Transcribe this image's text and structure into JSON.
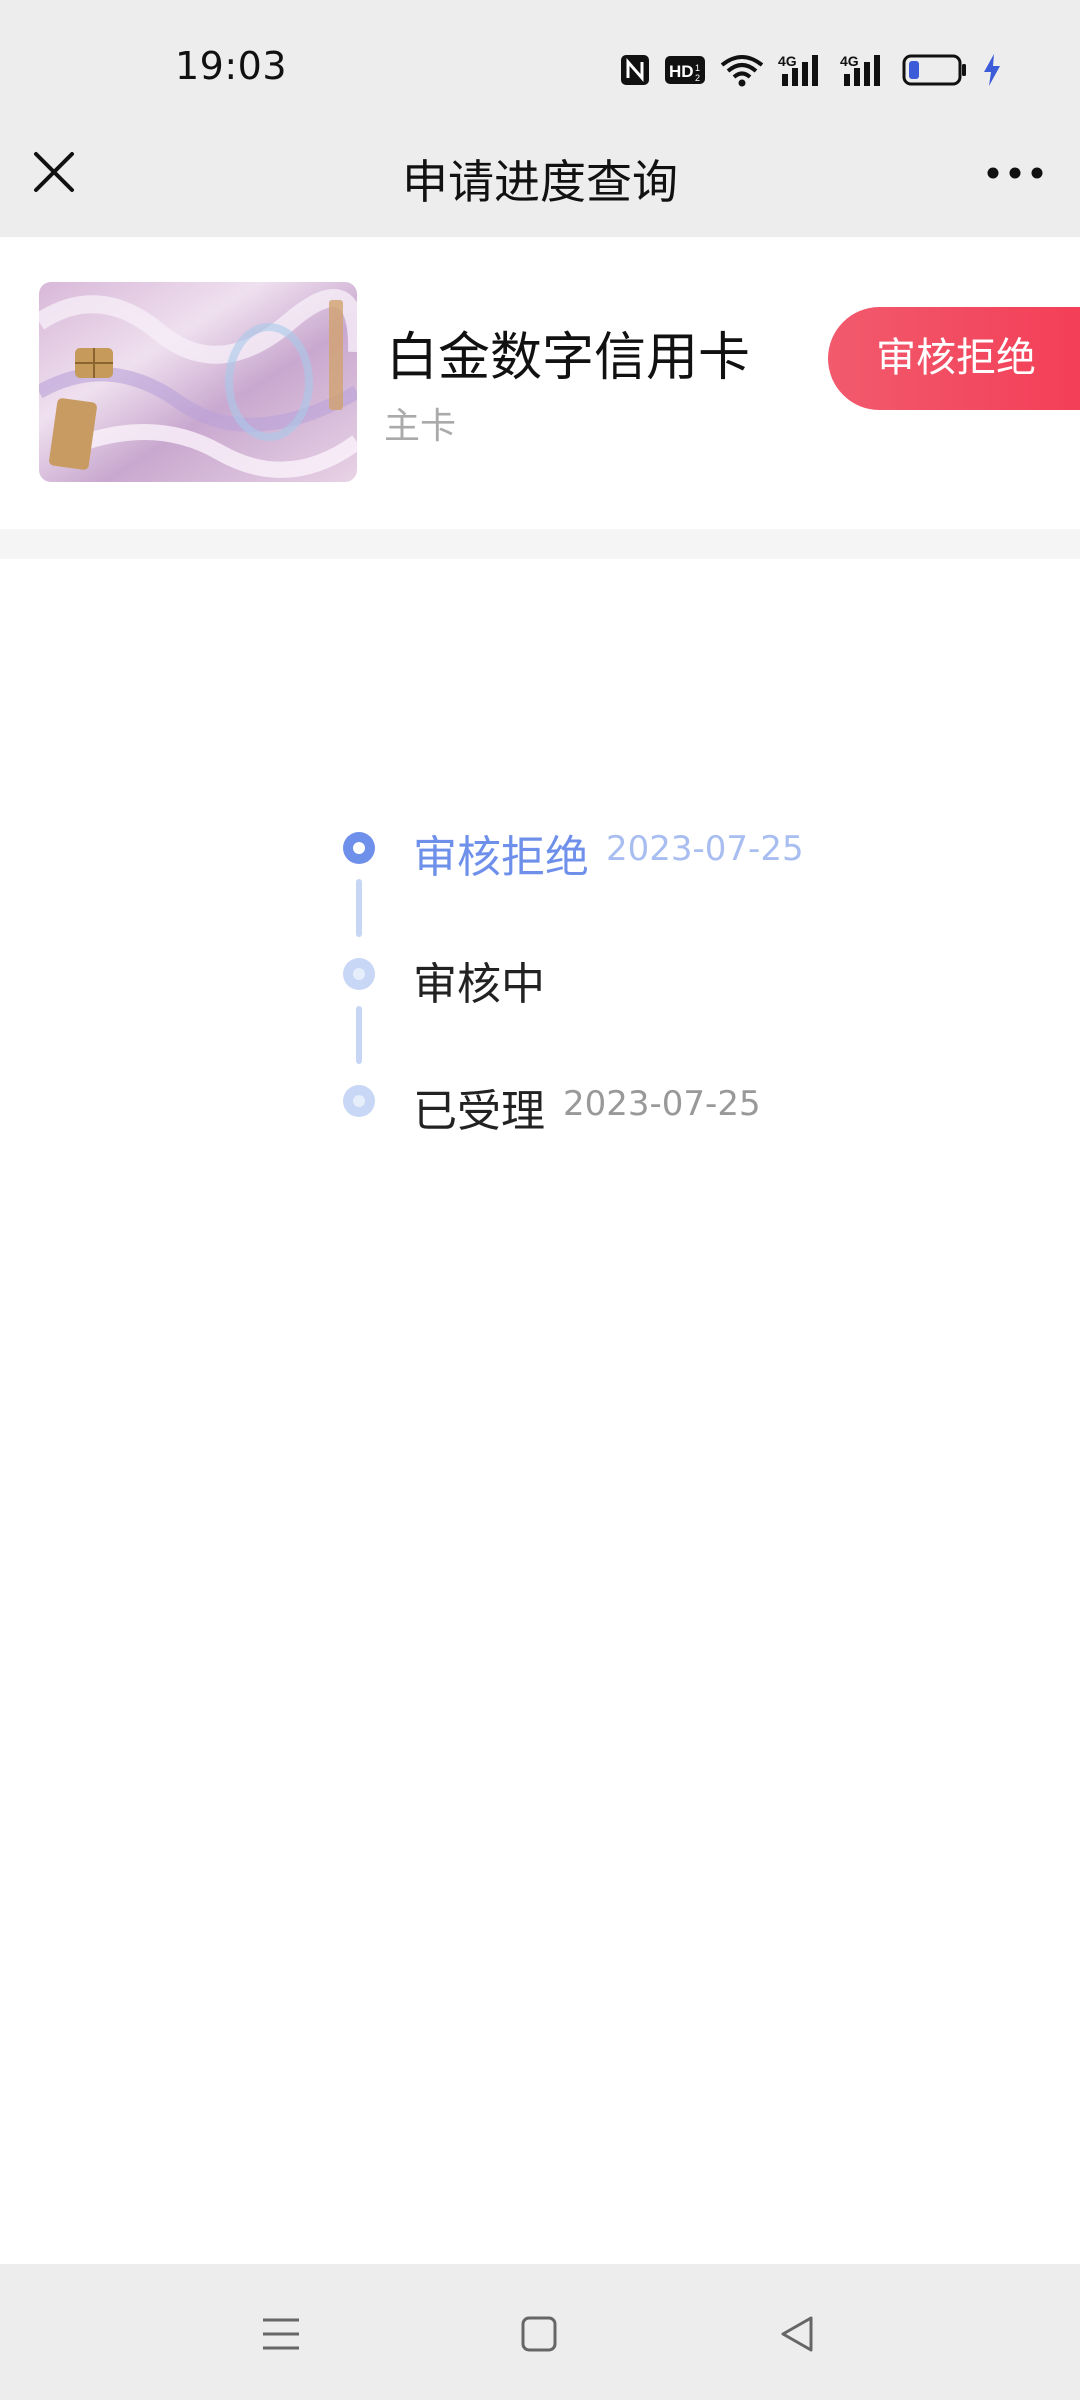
{
  "status_bar": {
    "time": "19:03",
    "icons": [
      "nfc-icon",
      "hd-icon",
      "wifi-icon",
      "signal-4g-icon",
      "signal-4g-icon",
      "battery-icon",
      "charging-icon"
    ]
  },
  "header": {
    "title": "申请进度查询",
    "close_icon": "close-icon",
    "more_icon": "more-icon"
  },
  "card": {
    "name": "白金数字信用卡",
    "type": "主卡",
    "status": "审核拒绝",
    "status_color": "#f33c55"
  },
  "timeline": {
    "accent_color": "#6f90ea",
    "steps": [
      {
        "label": "审核拒绝",
        "date": "2023-07-25",
        "active": true
      },
      {
        "label": "审核中",
        "date": "",
        "active": false
      },
      {
        "label": "已受理",
        "date": "2023-07-25",
        "active": false
      }
    ]
  },
  "system_nav": {
    "icons": [
      "menu-icon",
      "home-icon",
      "back-icon"
    ]
  }
}
